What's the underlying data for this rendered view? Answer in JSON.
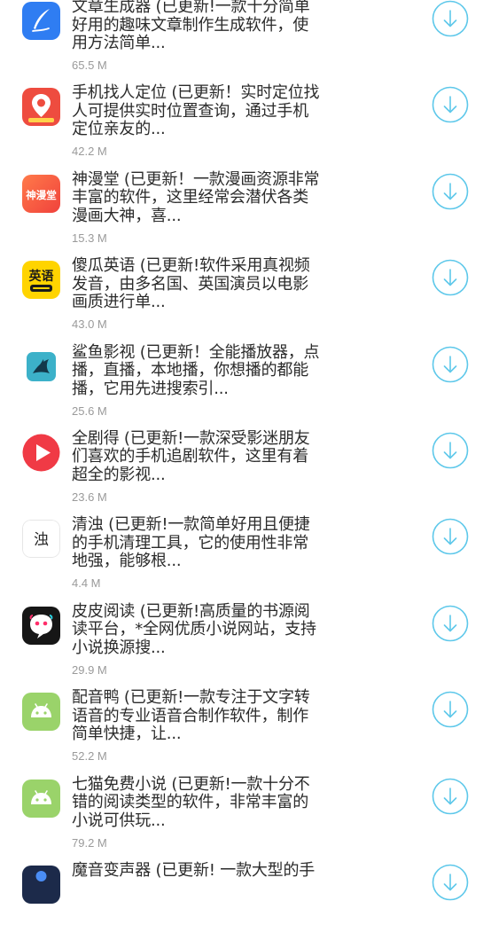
{
  "apps": [
    {
      "description": "文章生成器 (已更新!一款十分简单\n好用的趣味文章制作生成软件，使\n用方法简单...",
      "size": "65.5 M",
      "icon": "quill-pen-icon",
      "icon_text": ""
    },
    {
      "description": "手机找人定位 (已更新！实时定位找\n人可提供实时位置查询，通过手机\n定位亲友的...",
      "size": "42.2 M",
      "icon": "location-pin-icon",
      "icon_text": ""
    },
    {
      "description": "神漫堂 (已更新！一款漫画资源非常\n丰富的软件，这里经常会潜伏各类\n漫画大神，喜...",
      "size": "15.3 M",
      "icon": "shenmantang-logo-icon",
      "icon_text": "神漫堂"
    },
    {
      "description": "傻瓜英语 (已更新!软件采用真视频\n发音，由多名国、英国演员以电影\n画质进行单...",
      "size": "43.0 M",
      "icon": "english-vocab-icon",
      "icon_text": "英语"
    },
    {
      "description": "鲨鱼影视 (已更新！全能播放器，点\n播，直播，本地播，你想播的都能\n播，它用先进搜索引...",
      "size": "25.6 M",
      "icon": "shark-icon",
      "icon_text": ""
    },
    {
      "description": "全剧得 (已更新!一款深受影迷朋友\n们喜欢的手机追剧软件，这里有着\n超全的影视...",
      "size": "23.6 M",
      "icon": "play-button-icon",
      "icon_text": ""
    },
    {
      "description": "清浊 (已更新!一款简单好用且便捷\n的手机清理工具，它的使用性非常\n地强，能够根...",
      "size": "4.4 M",
      "icon": "qingzhuo-icon",
      "icon_text": "浊"
    },
    {
      "description": "皮皮阅读 (已更新!高质量的书源阅\n读平台，*全网优质小说网站，支持\n小说换源搜...",
      "size": "29.9 M",
      "icon": "chat-bubble-face-icon",
      "icon_text": ""
    },
    {
      "description": "配音鸭 (已更新!一款专注于文字转\n语音的专业语音合制作软件，制作\n简单快捷，让...",
      "size": "52.2 M",
      "icon": "android-icon",
      "icon_text": ""
    },
    {
      "description": "七猫免费小说 (已更新!一款十分不\n错的阅读类型的软件，非常丰富的\n小说可供玩...",
      "size": "79.2 M",
      "icon": "android-icon",
      "icon_text": ""
    },
    {
      "description": "魔音变声器 (已更新! 一款大型的手",
      "size": "",
      "icon": "app-icon-dark",
      "icon_text": ""
    }
  ],
  "colors": {
    "accent": "#5ec8ea",
    "text": "#2b2b2b",
    "size_text": "#9a9a9a"
  }
}
